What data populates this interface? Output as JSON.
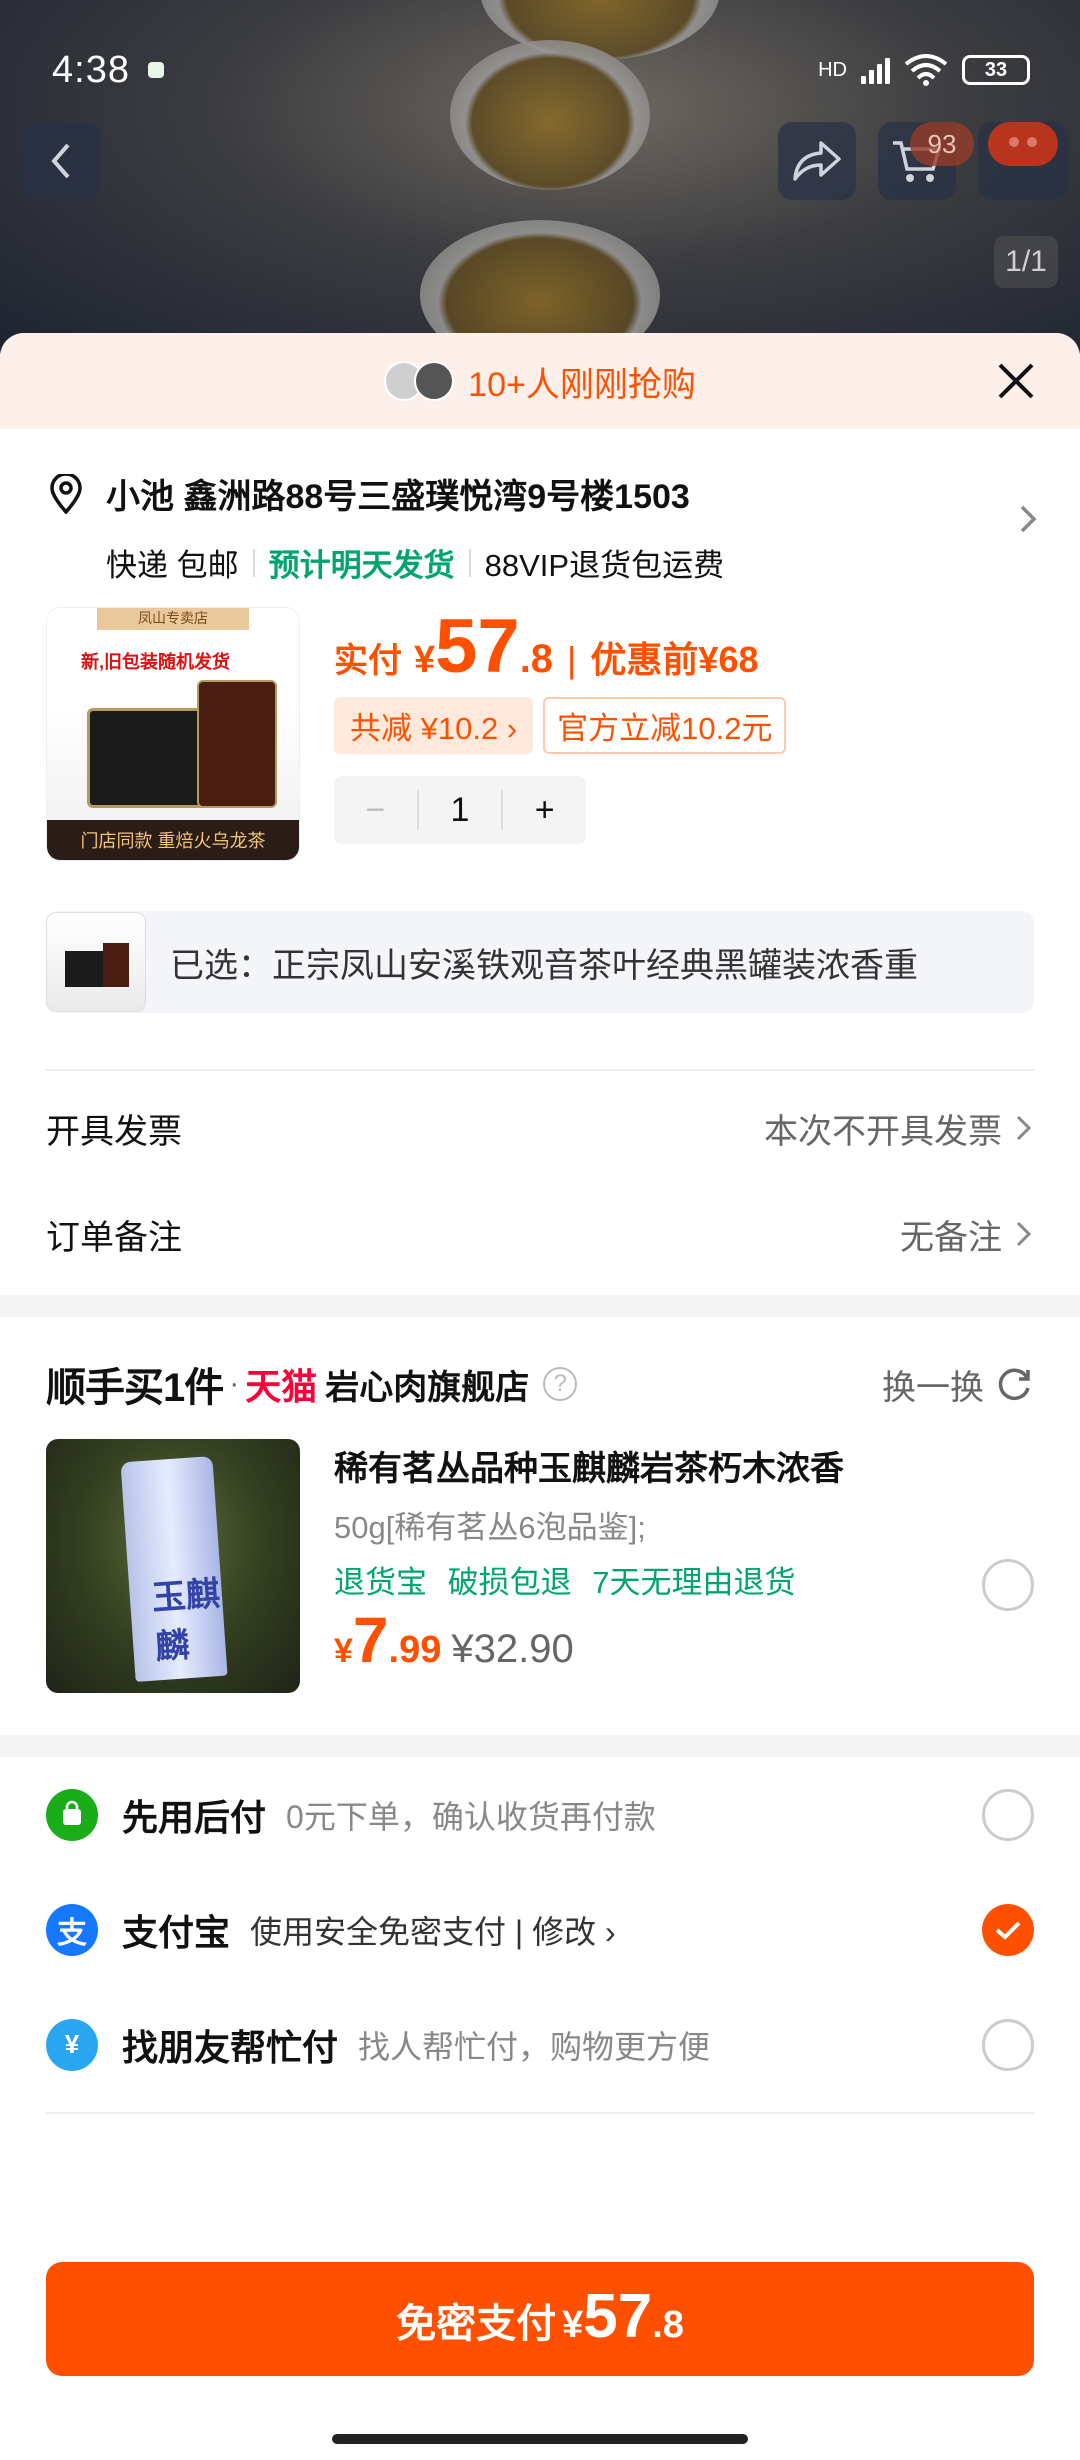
{
  "status_bar": {
    "time": "4:38",
    "network": "HD",
    "battery": "33"
  },
  "header": {
    "cart_count": "93",
    "image_pager": "1/1"
  },
  "banner": {
    "text": "10+人刚刚抢购"
  },
  "address": {
    "line": "小池 鑫洲路88号三盛璞悦湾9号楼1503",
    "ship_method": "快递 包邮",
    "ship_eta": "预计明天发货",
    "ship_note": "88VIP退货包运费"
  },
  "product": {
    "image_text": {
      "store": "凤山专卖店",
      "promo": "新,旧包装随机发货",
      "bottom": "门店同款 重焙火乌龙茶"
    },
    "paid_label": "实付",
    "currency": "¥",
    "price_int": "57",
    "price_dec": ".8",
    "before_label": "优惠前",
    "before_price": "¥68",
    "discount_tag": "共减 ¥10.2",
    "official_tag": "官方立减10.2元",
    "quantity": "1",
    "minus": "−",
    "plus": "+"
  },
  "selected": {
    "text": "已选：正宗凤山安溪铁观音茶叶经典黑罐装浓香重"
  },
  "invoice": {
    "label": "开具发票",
    "value": "本次不开具发票"
  },
  "remark": {
    "label": "订单备注",
    "value": "无备注"
  },
  "addon": {
    "title": "顺手买1件",
    "tmall": "天猫",
    "store": "岩心肉旗舰店",
    "swap": "换一换",
    "item": {
      "bag_text": "玉麒麟",
      "title": "稀有茗丛品种玉麒麟岩茶朽木浓香",
      "spec": "50g[稀有茗丛6泡品鉴];",
      "guarantees": "退货宝 破损包退 7天无理由退货",
      "currency": "¥",
      "price_int": "7",
      "price_dec": ".99",
      "old_price": "¥32.90"
    }
  },
  "payment": [
    {
      "name": "先用后付",
      "desc": "0元下单，确认收货再付款",
      "selected": false
    },
    {
      "name": "支付宝",
      "desc": "使用安全免密支付 | 修改 ›",
      "selected": true
    },
    {
      "name": "找朋友帮忙付",
      "desc": "找人帮忙付，购物更方便",
      "selected": false
    }
  ],
  "cta": {
    "label": "免密支付",
    "currency": "¥",
    "price_int": "57",
    "price_dec": ".8"
  },
  "colors": {
    "accent": "#ff5000",
    "green": "#00a56b",
    "tmall": "#ff0036",
    "alipay": "#1677ff",
    "paylater": "#1aad19"
  }
}
